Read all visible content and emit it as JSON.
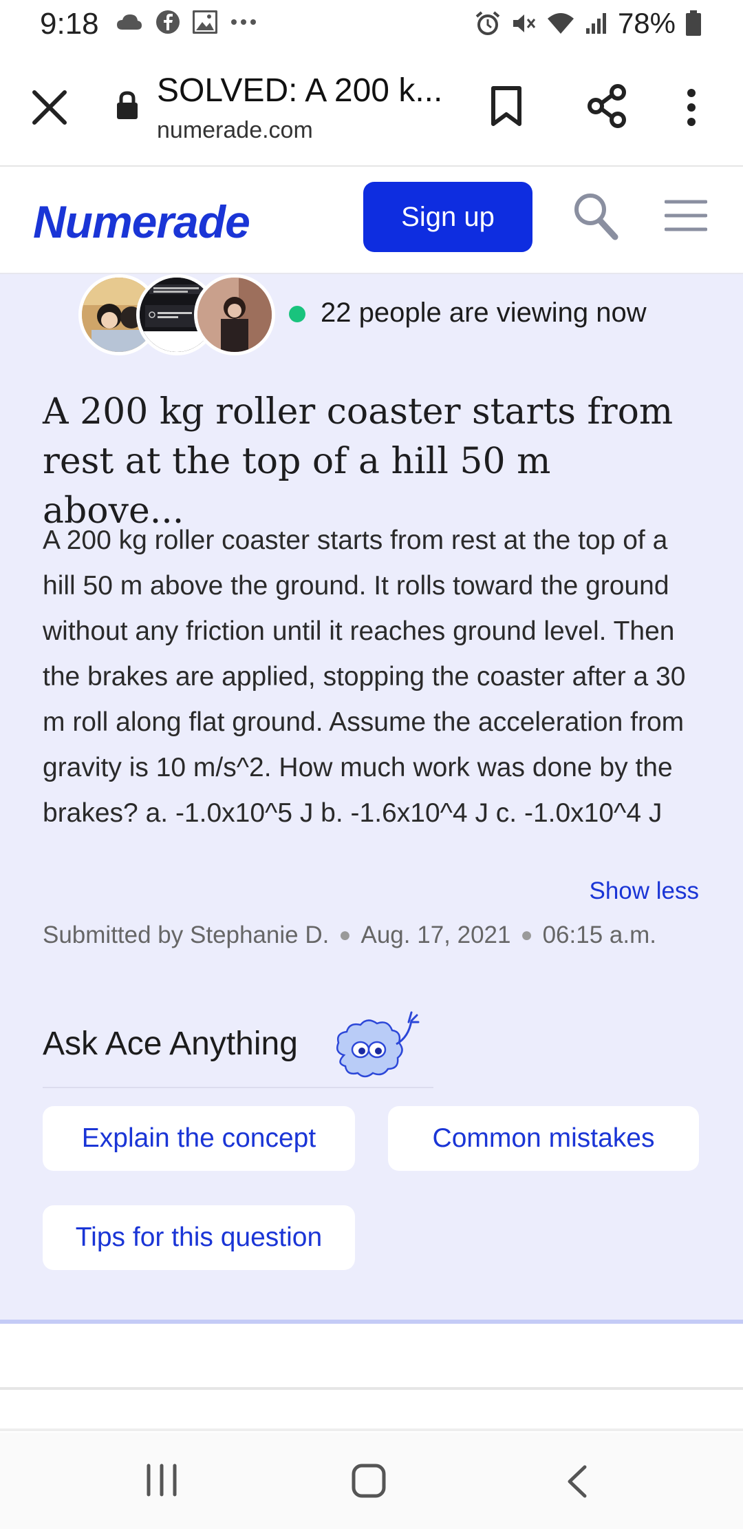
{
  "status_bar": {
    "time": "9:18",
    "icons_left": [
      "cloud-icon",
      "facebook-icon",
      "gallery-icon",
      "more-dots-icon"
    ],
    "icons_right": [
      "alarm-icon",
      "mute-icon",
      "wifi-icon",
      "signal-icon",
      "battery-icon"
    ],
    "battery": "78%"
  },
  "browser": {
    "tab_title": "SOLVED: A 200 k...",
    "domain": "numerade.com"
  },
  "header": {
    "logo": "Numerade",
    "signup_label": "Sign up",
    "brand_color": "#0e2de0"
  },
  "viewers": {
    "text": "22 people are viewing now",
    "dot_color": "#19c37d"
  },
  "question": {
    "title": "A 200 kg roller coaster starts from rest at the top of a hill 50 m above...",
    "body": "A 200 kg roller coaster starts from rest at the top of a hill 50 m above the ground. It rolls toward the ground without any friction until it reaches ground level. Then the brakes are applied, stopping the coaster after a 30 m roll along flat ground. Assume the acceleration from gravity is 10 m/s^2. How much work was done by the brakes? a. -1.0x10^5 J b. -1.6x10^4 J c. -1.0x10^4 J",
    "show_less": "Show less",
    "submitted_by": "Submitted by Stephanie D.",
    "date": "Aug. 17, 2021",
    "time": "06:15 a.m."
  },
  "ask_ace": {
    "title": "Ask Ace Anything",
    "chips": [
      "Explain the concept",
      "Common mistakes",
      "Tips for this question"
    ]
  },
  "colors": {
    "background_main": "#ecedfc",
    "link_blue": "#1a35d6"
  }
}
